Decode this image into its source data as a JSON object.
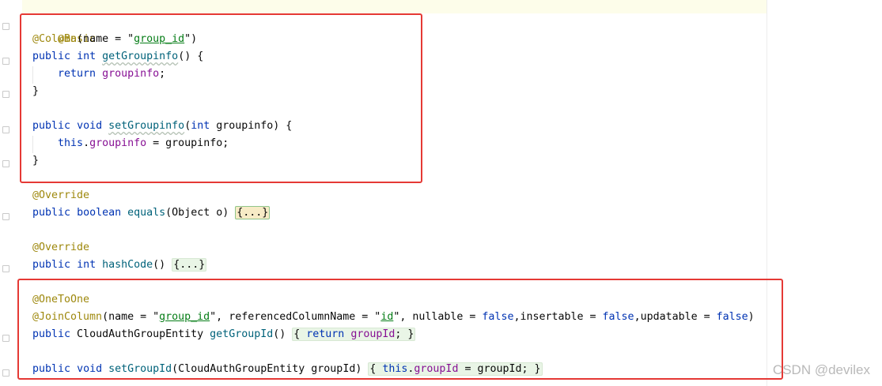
{
  "code": {
    "l1_ann": "@Basic",
    "l2_ann": "@Column",
    "l2_open": "(name = \"",
    "l2_str": "group_id",
    "l2_close": "\")",
    "l3_kw1": "public",
    "l3_kw2": "int",
    "l3_fn": "getGroupinfo",
    "l3_rest": "() {",
    "l4_kw": "return",
    "l4_fld": "groupinfo",
    "l4_rest": ";",
    "l5": "}",
    "l7_kw1": "public",
    "l7_kw2": "void",
    "l7_fn": "setGroupinfo",
    "l7_p1": "(",
    "l7_kw3": "int",
    "l7_p2": " groupinfo) {",
    "l8_kw": "this",
    "l8_dot": ".",
    "l8_fld": "groupinfo",
    "l8_rest": " = groupinfo;",
    "l9": "}",
    "l11_ann": "@Override",
    "l12_kw1": "public",
    "l12_kw2": "boolean",
    "l12_fn": "equals",
    "l12_rest": "(Object o) ",
    "l12_fold": "{...}",
    "l14_ann": "@Override",
    "l15_kw1": "public",
    "l15_kw2": "int",
    "l15_fn": "hashCode",
    "l15_rest": "() ",
    "l15_fold": "{...}",
    "l17_ann": "@OneToOne",
    "l18_ann": "@JoinColumn",
    "l18_a": "(name = \"",
    "l18_s1": "group_id",
    "l18_b": "\", referencedColumnName = \"",
    "l18_s2": "id",
    "l18_c": "\", nullable = ",
    "l18_k1": "false",
    "l18_d": ",insertable = ",
    "l18_k2": "false",
    "l18_e": ",updatable = ",
    "l18_k3": "false",
    "l18_f": ")",
    "l19_kw1": "public",
    "l19_type": " CloudAuthGroupEntity ",
    "l19_fn": "getGroupId",
    "l19_rest": "() ",
    "l19_f1": "{ ",
    "l19_kw2": "return",
    "l19_fld": "groupId",
    "l19_f2": "; }",
    "l21_kw1": "public",
    "l21_kw2": "void",
    "l21_fn": "setGroupId",
    "l21_rest": "(CloudAuthGroupEntity groupId) ",
    "l21_f1": "{ ",
    "l21_kw3": "this",
    "l21_dot": ".",
    "l21_fld": "groupId",
    "l21_f2": " = groupId; }"
  },
  "watermark": "CSDN @devilex",
  "colors": {
    "annotation": "#9e880d",
    "keyword": "#0033b3",
    "method": "#00627a",
    "field": "#871094",
    "string": "#067d17",
    "highlight_box": "#e53935"
  }
}
